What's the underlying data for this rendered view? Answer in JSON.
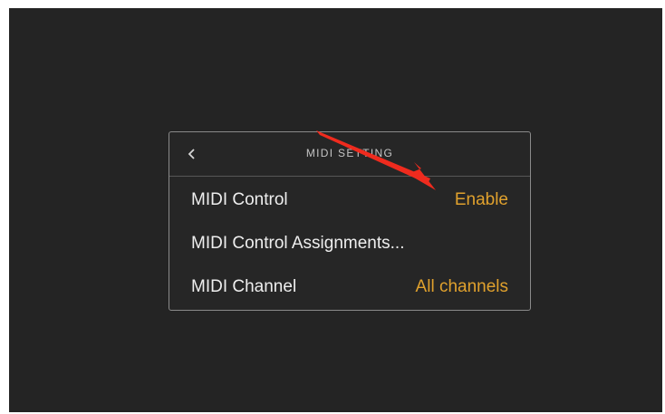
{
  "header": {
    "title": "MIDI SETTING",
    "back_icon": "chevron-left-icon"
  },
  "settings": [
    {
      "label": "MIDI Control",
      "value": "Enable"
    },
    {
      "label": "MIDI Control Assignments...",
      "value": ""
    },
    {
      "label": "MIDI Channel",
      "value": "All channels"
    }
  ],
  "colors": {
    "screen_bg": "#242424",
    "panel_border": "#8a8a8a",
    "value_accent": "#e0a12d",
    "annotation_arrow": "#ef2b1e"
  }
}
